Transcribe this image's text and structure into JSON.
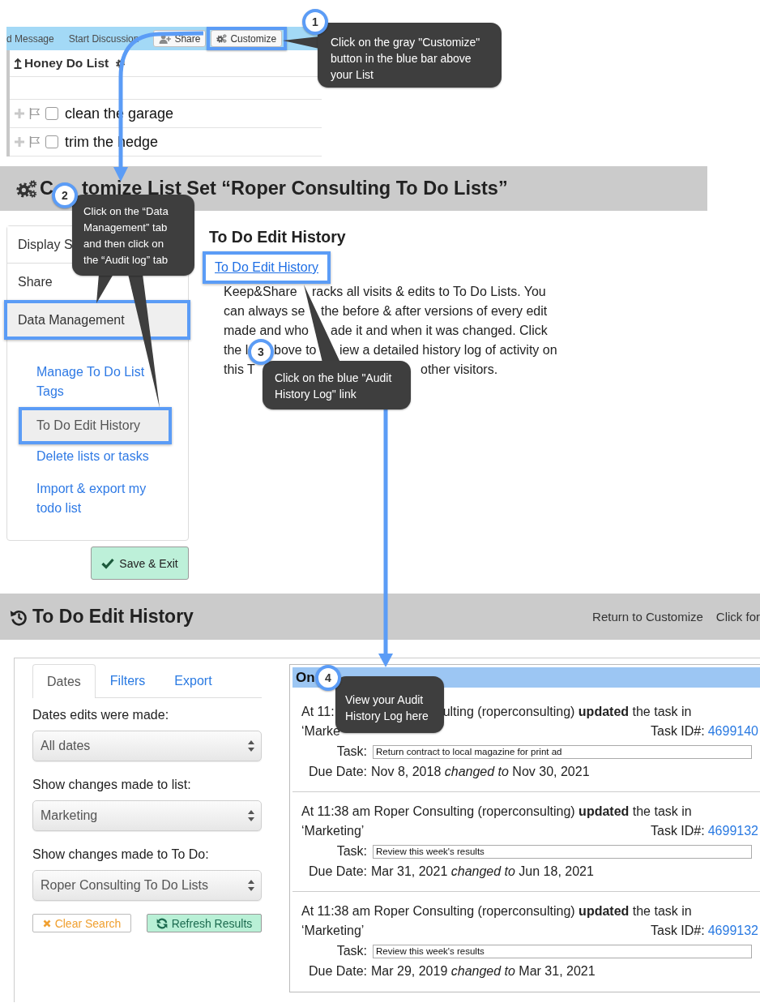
{
  "top_strip": {
    "toolbar": [
      {
        "kind": "link",
        "label": "d Message",
        "highlighted": false
      },
      {
        "kind": "link",
        "label": "Start Discussion",
        "highlighted": false
      },
      {
        "kind": "button",
        "label": "Share",
        "highlighted": false
      },
      {
        "kind": "button",
        "label": "Customize",
        "highlighted": true
      }
    ],
    "list_title": "Honey Do List",
    "tasks": [
      {
        "label": "clean the garage",
        "checked": false
      },
      {
        "label": "trim the hedge",
        "checked": false
      }
    ]
  },
  "customize": {
    "title_parts": [
      "C",
      "tomize List Set “Roper Consulting To Do Lists”"
    ],
    "sidebar_tabs": [
      {
        "label": "Display S",
        "selected": false,
        "highlighted": false
      },
      {
        "label": "Share",
        "selected": false,
        "highlighted": false
      },
      {
        "label": "Data Management",
        "selected": true,
        "highlighted": true
      }
    ],
    "sidebar_items": [
      {
        "label": "Manage To Do List Tags",
        "selected": false,
        "highlighted": false
      },
      {
        "label": "To Do Edit History",
        "selected": true,
        "highlighted": true
      },
      {
        "label": "Delete lists or tasks",
        "selected": false,
        "highlighted": false
      },
      {
        "label": "Import & export my todo list",
        "selected": false,
        "highlighted": false
      }
    ],
    "save_button": "Save & Exit",
    "heading": "To Do Edit History",
    "link": {
      "label": "To Do Edit History",
      "highlighted": true
    },
    "description_visible_fragments": [
      [
        "Keep&Share",
        "racks all visits & edits to To Do Lists. You"
      ],
      [
        "can always se",
        "the before & after versions of every edit"
      ],
      [
        "made and who",
        "ade it and when it was changed. Click"
      ],
      [
        "the l",
        "bove to",
        "iew a detailed history log of activity on"
      ],
      [
        "this T",
        "other visitors."
      ]
    ]
  },
  "history": {
    "title": "To Do Edit History",
    "nav_links": [
      "Return to Customize",
      "Click for"
    ],
    "filter_tabs": [
      {
        "label": "Dates",
        "selected": true
      },
      {
        "label": "Filters",
        "selected": false
      },
      {
        "label": "Export",
        "selected": false
      }
    ],
    "filters": [
      {
        "label": "Dates edits were made:",
        "value": "All dates"
      },
      {
        "label": "Show changes made to list:",
        "value": "Marketing"
      },
      {
        "label": "Show changes made to To Do:",
        "value": "Roper Consulting To Do Lists"
      }
    ],
    "buttons": [
      {
        "kind": "clear",
        "label": "Clear Search"
      },
      {
        "kind": "refresh",
        "label": "Refresh Results"
      }
    ],
    "day_header": "On",
    "entries": [
      {
        "summary_parts": [
          "At 11:",
          "ulting (roperconsulting) **updated** the task in"
        ],
        "list_name": "‘Marke",
        "task_id_label": "Task ID#:",
        "task_id": "4699140",
        "task_label": "Task:",
        "task": "Return contract to local magazine for print ad",
        "due_label": "Due Date:",
        "due_change": "Nov 8, 2018 *changed to* Nov 30, 2021"
      },
      {
        "summary_parts": [
          "At 11:38 am Roper Consulting (roperconsulting) **updated** the task in"
        ],
        "list_name": "‘Marketing’",
        "task_id_label": "Task ID#:",
        "task_id": "4699132",
        "task_label": "Task:",
        "task": "Review this week's results",
        "due_label": "Due Date:",
        "due_change": "Mar 31, 2021 *changed to* Jun 18, 2021"
      },
      {
        "summary_parts": [
          "At 11:38 am Roper Consulting (roperconsulting) **updated** the task in"
        ],
        "list_name": "‘Marketing’",
        "task_id_label": "Task ID#:",
        "task_id": "4699132",
        "task_label": "Task:",
        "task": "Review this week's results",
        "due_label": "Due Date:",
        "due_change": "Mar 29, 2019 *changed to* Mar 31, 2021"
      }
    ]
  },
  "callouts": [
    {
      "number": "1",
      "text": "Click on the gray \"Customize\" button in the blue bar above your List"
    },
    {
      "number": "2",
      "text": "Click on the “Data Management” tab and then click on the “Audit log” tab"
    },
    {
      "number": "3",
      "text": "Click on the blue \"Audit History Log\" link"
    },
    {
      "number": "4",
      "text": "View your Audit History Log here"
    }
  ]
}
